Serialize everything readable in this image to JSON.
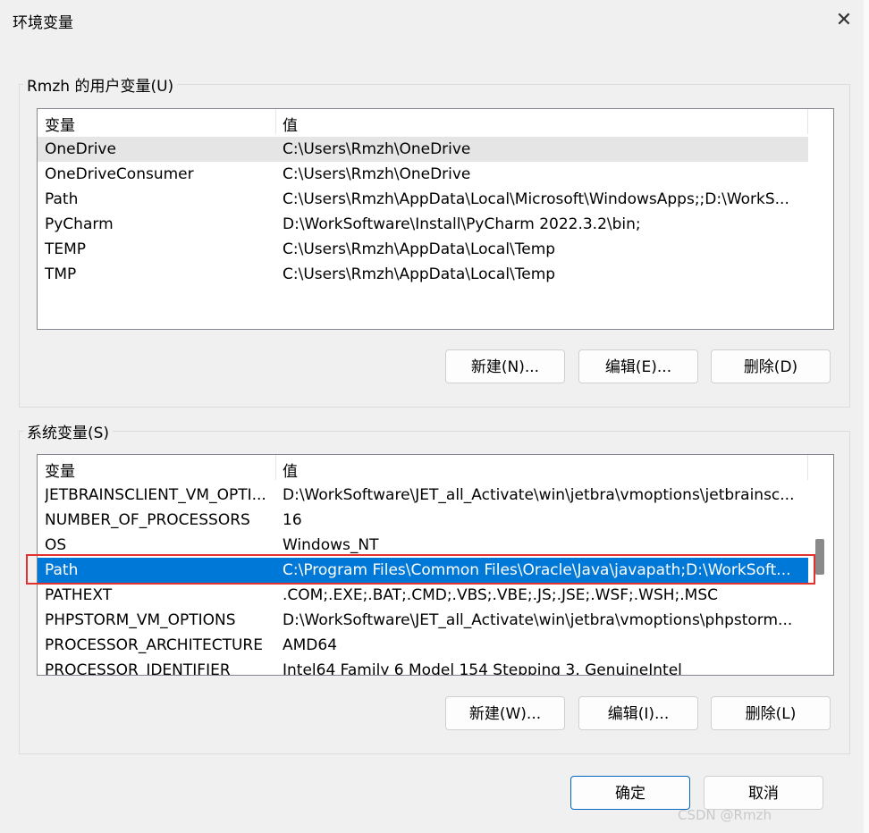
{
  "window": {
    "title": "环境变量",
    "close_icon": "close-icon"
  },
  "user_vars": {
    "group_label": "Rmzh 的用户变量(U)",
    "headers": [
      "变量",
      "值"
    ],
    "rows": [
      {
        "name": "OneDrive",
        "value": "C:\\Users\\Rmzh\\OneDrive"
      },
      {
        "name": "OneDriveConsumer",
        "value": "C:\\Users\\Rmzh\\OneDrive"
      },
      {
        "name": "Path",
        "value": "C:\\Users\\Rmzh\\AppData\\Local\\Microsoft\\WindowsApps;;D:\\WorkS..."
      },
      {
        "name": "PyCharm",
        "value": "D:\\WorkSoftware\\Install\\PyCharm 2022.3.2\\bin;"
      },
      {
        "name": "TEMP",
        "value": "C:\\Users\\Rmzh\\AppData\\Local\\Temp"
      },
      {
        "name": "TMP",
        "value": "C:\\Users\\Rmzh\\AppData\\Local\\Temp"
      }
    ],
    "buttons": {
      "new": "新建(N)...",
      "edit": "编辑(E)...",
      "delete": "删除(D)"
    }
  },
  "system_vars": {
    "group_label": "系统变量(S)",
    "headers": [
      "变量",
      "值"
    ],
    "rows": [
      {
        "name": "JETBRAINSCLIENT_VM_OPTI...",
        "value": "D:\\WorkSoftware\\JET_all_Activate\\win\\jetbra\\vmoptions\\jetbrainsc..."
      },
      {
        "name": "NUMBER_OF_PROCESSORS",
        "value": "16"
      },
      {
        "name": "OS",
        "value": "Windows_NT"
      },
      {
        "name": "Path",
        "value": "C:\\Program Files\\Common Files\\Oracle\\Java\\javapath;D:\\WorkSoft..."
      },
      {
        "name": "PATHEXT",
        "value": ".COM;.EXE;.BAT;.CMD;.VBS;.VBE;.JS;.JSE;.WSF;.WSH;.MSC"
      },
      {
        "name": "PHPSTORM_VM_OPTIONS",
        "value": "D:\\WorkSoftware\\JET_all_Activate\\win\\jetbra\\vmoptions\\phpstorm..."
      },
      {
        "name": "PROCESSOR_ARCHITECTURE",
        "value": "AMD64"
      },
      {
        "name": "PROCESSOR_IDENTIFIER",
        "value": "Intel64 Family 6 Model 154 Stepping 3, GenuineIntel"
      }
    ],
    "selected_row": "Path",
    "buttons": {
      "new": "新建(W)...",
      "edit": "编辑(I)...",
      "delete": "删除(L)"
    }
  },
  "footer": {
    "ok": "确定",
    "cancel": "取消"
  },
  "watermark": "CSDN @Rmzh",
  "colors": {
    "selection": "#0078d7",
    "highlight_box": "#e2312f"
  }
}
